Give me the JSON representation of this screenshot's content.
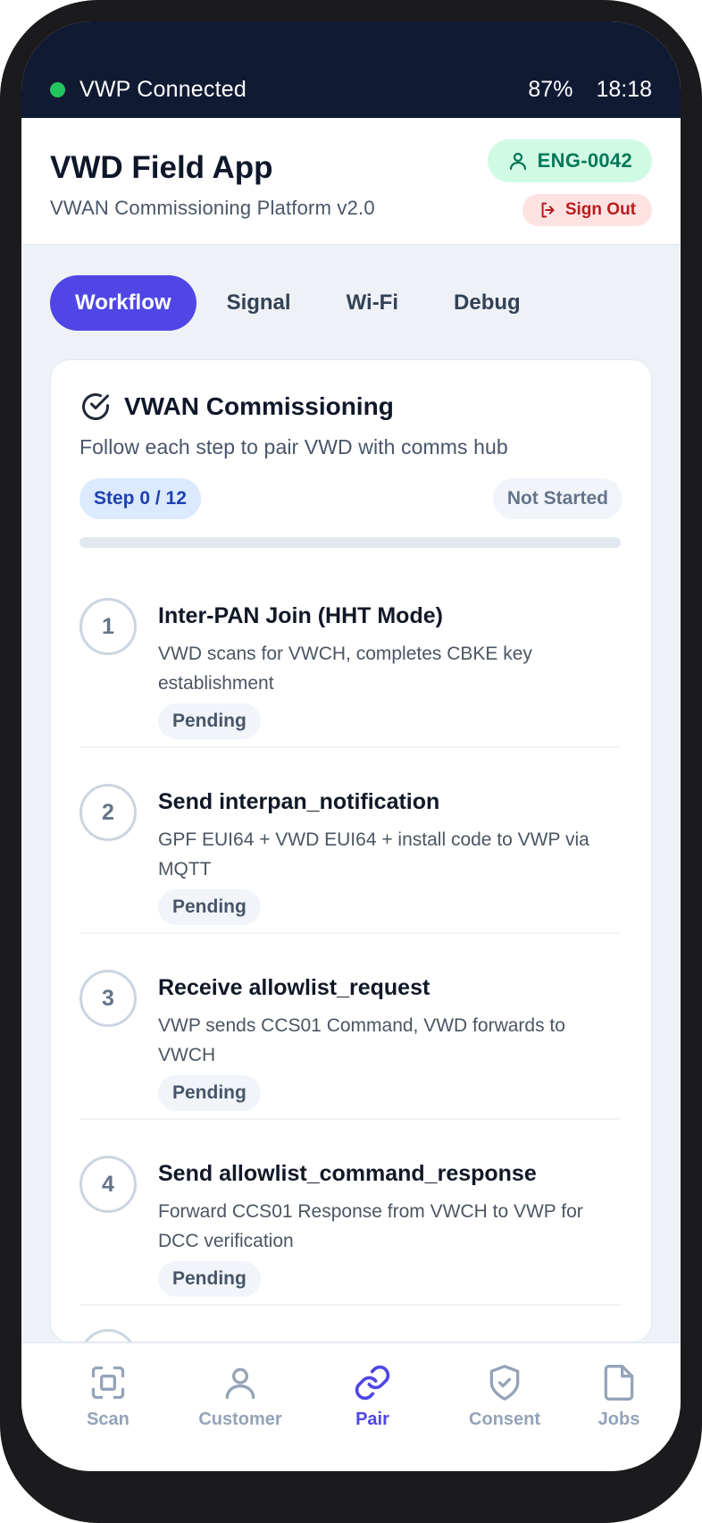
{
  "status_bar": {
    "connection_label": "VWP Connected",
    "battery": "87%",
    "time": "18:18"
  },
  "header": {
    "title": "VWD Field App",
    "subtitle": "VWAN Commissioning Platform v2.0",
    "user_id": "ENG-0042",
    "sign_out_label": "Sign Out"
  },
  "tabs": [
    {
      "label": "Workflow",
      "active": true
    },
    {
      "label": "Signal",
      "active": false
    },
    {
      "label": "Wi-Fi",
      "active": false
    },
    {
      "label": "Debug",
      "active": false
    }
  ],
  "card": {
    "title": "VWAN Commissioning",
    "description": "Follow each step to pair VWD with comms hub",
    "step_counter": "Step 0 / 12",
    "state": "Not Started",
    "progress_fraction": 0,
    "steps": [
      {
        "number": "1",
        "title": "Inter-PAN Join (HHT Mode)",
        "description": "VWD scans for VWCH, completes CBKE key establishment",
        "status": "Pending"
      },
      {
        "number": "2",
        "title": "Send interpan_notification",
        "description": "GPF EUI64 + VWD EUI64 + install code to VWP via MQTT",
        "status": "Pending"
      },
      {
        "number": "3",
        "title": "Receive allowlist_request",
        "description": "VWP sends CCS01 Command, VWD forwards to VWCH",
        "status": "Pending"
      },
      {
        "number": "4",
        "title": "Send allowlist_command_response",
        "description": "Forward CCS01 Response from VWCH to VWP for DCC verification",
        "status": "Pending"
      }
    ]
  },
  "bottom_nav": [
    {
      "label": "Scan",
      "icon": "scan-icon",
      "active": false
    },
    {
      "label": "Customer",
      "icon": "user-icon",
      "active": false
    },
    {
      "label": "Pair",
      "icon": "link-icon",
      "active": true
    },
    {
      "label": "Consent",
      "icon": "shield-check-icon",
      "active": false
    },
    {
      "label": "Jobs",
      "icon": "document-icon",
      "active": false
    }
  ],
  "colors": {
    "accent": "#4f46e5",
    "status_bar_bg": "#111a33",
    "connected_dot": "#22c55e",
    "user_badge_bg": "#d1fae5",
    "sign_out_bg": "#fee2e2"
  }
}
